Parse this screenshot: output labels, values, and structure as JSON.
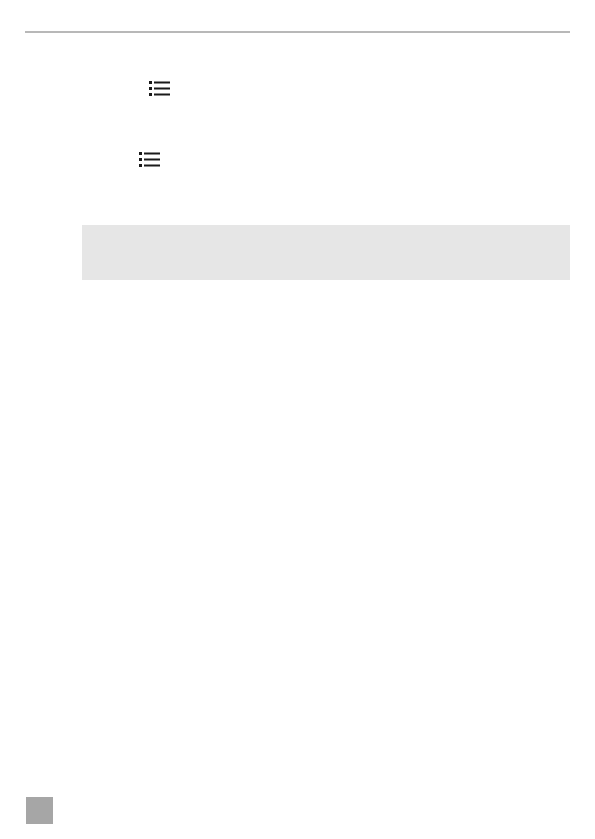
{
  "page": {
    "icons": [
      {
        "name": "list-icon"
      },
      {
        "name": "list-icon"
      }
    ],
    "note_box": {
      "text": ""
    },
    "page_marker": {
      "label": ""
    }
  },
  "colors": {
    "rule": "#b8b8b8",
    "icon": "#1a1a1a",
    "note_background": "#e6e6e6",
    "page_tab": "#a6a6a6"
  }
}
